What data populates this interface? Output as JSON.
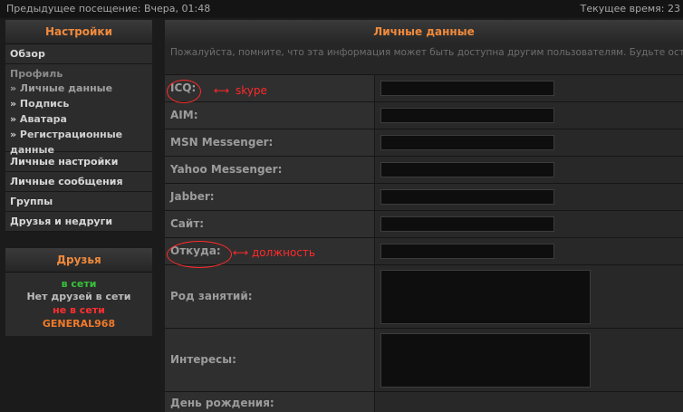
{
  "topbar": {
    "last_visit": "Предыдущее посещение: Вчера, 01:48",
    "current_time": "Текущее время: 23"
  },
  "sidebar": {
    "title": "Настройки",
    "overview": "Обзор",
    "profile": {
      "caption": "Профиль",
      "items": [
        "» Личные данные",
        "» Подпись",
        "» Аватара",
        "» Регистрационные",
        "данные"
      ]
    },
    "items": [
      "Личные настройки",
      "Личные сообщения",
      "Группы",
      "Друзья и недруги"
    ]
  },
  "friends": {
    "title": "Друзья",
    "online_label": "в сети",
    "no_friends": "Нет друзей в сети",
    "offline_label": "не в сети",
    "offline_user": "GENERAL968"
  },
  "main": {
    "title": "Личные данные",
    "notice": "Пожалуйста, помните, что эта информация может быть доступна другим пользователям. Будьте осторожны при выборе указываемых персональных данных. Любые поля, обозначенные * должны быть заполнены.",
    "fields": {
      "icq": "ICQ:",
      "aim": "AIM:",
      "msn": "MSN Messenger:",
      "yahoo": "Yahoo Messenger:",
      "jabber": "Jabber:",
      "site": "Сайт:",
      "from": "Откуда:",
      "occupation": "Род занятий:",
      "interests": "Интересы:",
      "birthday": "День рождения:"
    }
  },
  "annotations": {
    "icq_note": "skype",
    "from_note": "должность"
  },
  "colors": {
    "accent": "#f08a3c",
    "annotation": "#ff2a2a",
    "online": "#36c23a",
    "offline": "#ff2f2f"
  }
}
